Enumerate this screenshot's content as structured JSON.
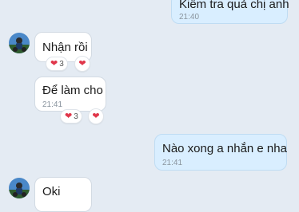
{
  "colors": {
    "background": "#e4ebf3",
    "incoming_bubble": "#ffffff",
    "outgoing_bubble": "#d9eeff",
    "heart": "#e0364a"
  },
  "messages": [
    {
      "direction": "outgoing",
      "text": "Kiểm tra quả chị anh",
      "time": "21:40"
    },
    {
      "direction": "incoming",
      "text": "Nhận rồi",
      "reaction_count": "3",
      "reaction_icon": "heart-icon"
    },
    {
      "direction": "incoming",
      "text": "Để làm cho",
      "time": "21:41",
      "reaction_count": "3",
      "reaction_icon": "heart-icon"
    },
    {
      "direction": "outgoing",
      "text": "Nào xong a nhắn e nha",
      "time": "21:41"
    },
    {
      "direction": "incoming",
      "text": "Oki"
    }
  ]
}
